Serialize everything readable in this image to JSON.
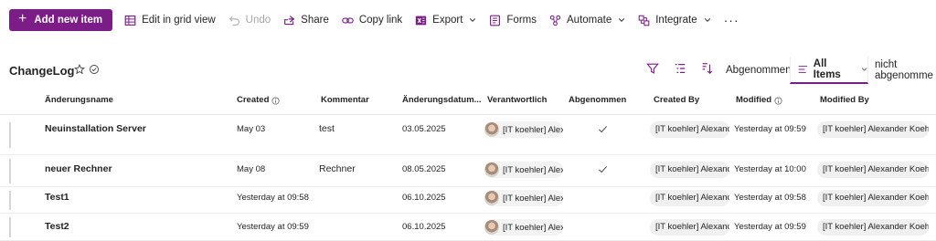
{
  "toolbar": {
    "add_new_item": "Add new item",
    "edit_grid": "Edit in grid view",
    "undo": "Undo",
    "share": "Share",
    "copy_link": "Copy link",
    "export": "Export",
    "forms": "Forms",
    "automate": "Automate",
    "integrate": "Integrate",
    "more": "···"
  },
  "list": {
    "title": "ChangeLog"
  },
  "views": {
    "abgenommen": "Abgenommen",
    "all_items": "All Items",
    "nicht_abgenommen": "nicht abgenomme"
  },
  "columns": {
    "name": "Änderungsname",
    "created": "Created",
    "kommentar": "Kommentar",
    "datum": "Änderungsdatum...",
    "verantwortlich": "Verantwortlich",
    "abgenommen": "Abgenommen",
    "created_by": "Created By",
    "modified": "Modified",
    "modified_by": "Modified By"
  },
  "rows": [
    {
      "name": "Neuinstallation Server",
      "created": "May 03",
      "kommentar": "test",
      "datum": "03.05.2025",
      "verantwortlich": "[IT koehler] Alexa",
      "abgenommen": true,
      "created_by": "[IT koehler] Alexander",
      "modified": "Yesterday at 09:59",
      "modified_by": "[IT koehler] Alexander Koehler"
    },
    {
      "name": "neuer Rechner",
      "created": "May 08",
      "kommentar": "Rechner",
      "datum": "08.05.2025",
      "verantwortlich": "[IT koehler] Alexa",
      "abgenommen": true,
      "created_by": "[IT koehler] Alexander",
      "modified": "Yesterday at 10:00",
      "modified_by": "[IT koehler] Alexander Koehler"
    },
    {
      "name": "Test1",
      "created": "Yesterday at 09:58",
      "kommentar": "",
      "datum": "06.10.2025",
      "verantwortlich": "[IT koehler] Alexa",
      "abgenommen": false,
      "created_by": "[IT koehler] Alexander",
      "modified": "Yesterday at 09:58",
      "modified_by": "[IT koehler] Alexander Koehler"
    },
    {
      "name": "Test2",
      "created": "Yesterday at 09:59",
      "kommentar": "",
      "datum": "06.10.2025",
      "verantwortlich": "[IT koehler] Alexa",
      "abgenommen": false,
      "created_by": "[IT koehler] Alexander",
      "modified": "Yesterday at 09:59",
      "modified_by": "[IT koehler] Alexander Koehler"
    }
  ],
  "colors": {
    "accent": "#7b1c87"
  }
}
